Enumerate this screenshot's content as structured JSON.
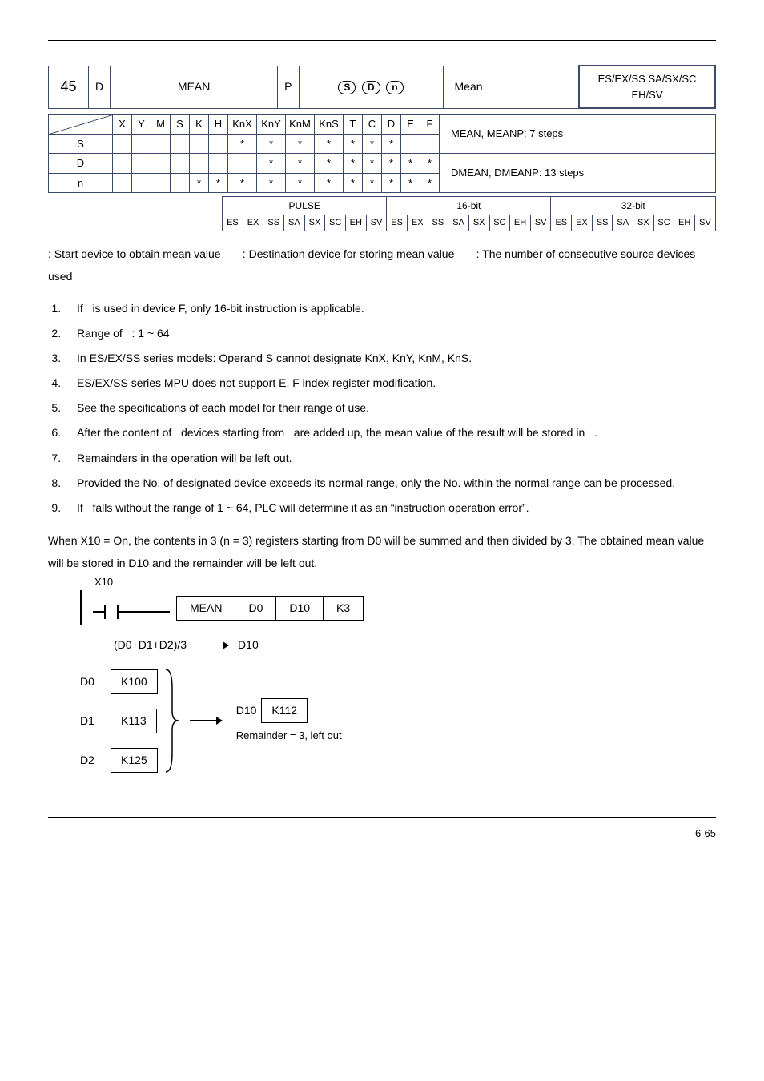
{
  "header": {
    "api_num": "45",
    "d_col": "D",
    "mean_col": "MEAN",
    "p_col": "P",
    "desc": "Mean",
    "models": "ES/EX/SS SA/SX/SC EH/SV"
  },
  "grid": {
    "row_head": [
      "X",
      "Y",
      "M",
      "S",
      "K",
      "H",
      "KnX",
      "KnY",
      "KnM",
      "KnS",
      "T",
      "C",
      "D",
      "E",
      "F"
    ],
    "row_S": [
      "",
      "",
      "",
      "",
      "",
      "",
      "*",
      "*",
      "*",
      "*",
      "*",
      "*",
      "*",
      "",
      ""
    ],
    "row_D": [
      "",
      "",
      "",
      "",
      "",
      "",
      "",
      "*",
      "*",
      "*",
      "*",
      "*",
      "*",
      "*",
      "*"
    ],
    "row_n": [
      "",
      "",
      "",
      "",
      "*",
      "*",
      "*",
      "*",
      "*",
      "*",
      "*",
      "*",
      "*",
      "*",
      "*"
    ],
    "steps_mean": "MEAN, MEANP: 7 steps",
    "steps_dmean": "DMEAN, DMEANP: 13 steps"
  },
  "pulse": {
    "head_pulse": "PULSE",
    "head_16": "16-bit",
    "head_32": "32-bit",
    "cells": [
      "ES",
      "EX",
      "SS",
      "SA",
      "SX",
      "SC",
      "EH",
      "SV",
      "ES",
      "EX",
      "SS",
      "SA",
      "SX",
      "SC",
      "EH",
      "SV",
      "ES",
      "EX",
      "SS",
      "SA",
      "SX",
      "SC",
      "EH",
      "SV"
    ]
  },
  "operands_text": ": Start device to obtain mean value       : Destination device for storing mean value       : The number of consecutive source devices used",
  "list": [
    "If   is used in device F, only 16-bit instruction is applicable.",
    "Range of   : 1 ~ 64",
    "In ES/EX/SS series models: Operand S cannot designate KnX, KnY, KnM, KnS.",
    "ES/EX/SS series MPU does not support E, F index register modification.",
    "See the specifications of each model for their range of use.",
    "After the content of   devices starting from   are added up, the mean value of the result will be stored in   .",
    "Remainders in the operation will be left out.",
    "Provided the No. of designated device exceeds its normal range, only the No. within the normal range can be processed.",
    "If   falls without the range of 1 ~ 64, PLC will determine it as an “instruction operation error”."
  ],
  "example_text": "When X10 = On, the contents in 3 (n = 3) registers starting from D0 will be summed and then divided by 3. The obtained mean value will be stored in D10 and the remainder will be left out.",
  "diagram": {
    "contact": "X10",
    "inst": [
      "MEAN",
      "D0",
      "D10",
      "K3"
    ],
    "formula": "(D0+D1+D2)/3",
    "formula_result": "D10",
    "regs": [
      {
        "label": "D0",
        "value": "K100"
      },
      {
        "label": "D1",
        "value": "K113"
      },
      {
        "label": "D2",
        "value": "K125"
      }
    ],
    "result_reg": "D10",
    "result_val": "K112",
    "remainder": "Remainder = 3, left out"
  },
  "footer": "6-65"
}
